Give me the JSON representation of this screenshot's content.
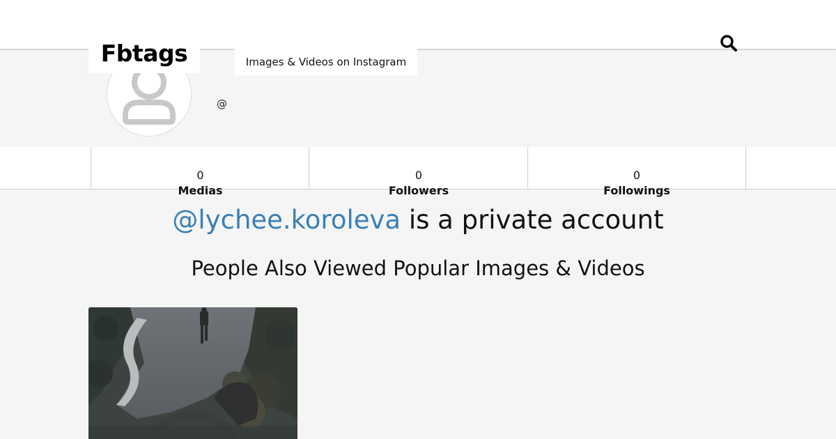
{
  "header": {
    "logo": "Fbtags",
    "tagline": "Images & Videos on Instagram",
    "search_icon": "search-icon"
  },
  "profile": {
    "avatar_icon": "user-placeholder-icon",
    "handle_prefix": "@"
  },
  "stats": [
    {
      "value": "0",
      "label": "Medias"
    },
    {
      "value": "0",
      "label": "Followers"
    },
    {
      "value": "0",
      "label": "Followings"
    }
  ],
  "notice": {
    "username": "@lychee.koroleva",
    "text": " is a private account"
  },
  "related": {
    "title": "People Also Viewed Popular Images & Videos"
  },
  "colors": {
    "link": "#3a7fb5",
    "background": "#f5f5f5",
    "card": "#ffffff"
  }
}
